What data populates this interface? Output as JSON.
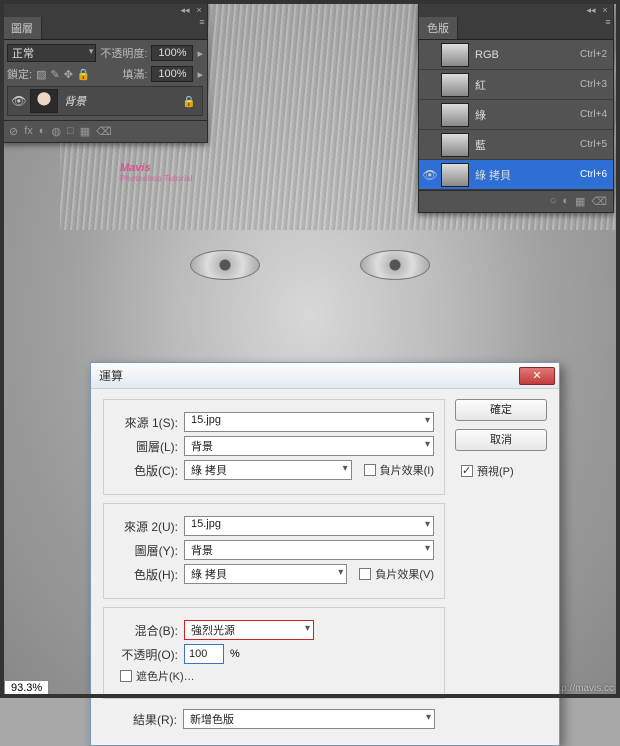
{
  "canvas": {
    "zoom": "93.3%",
    "watermark": "Mavis",
    "watermark_sub": "Photoshop Tutorial",
    "site": "http://mavis.cc"
  },
  "layers_panel": {
    "tab": "圖層",
    "blend_mode": "正常",
    "opacity_label": "不透明度:",
    "opacity_value": "100%",
    "lock_label": "鎖定:",
    "fill_label": "填滿:",
    "fill_value": "100%",
    "layer": {
      "name": "背景"
    },
    "foot_icons": [
      "⊘",
      "fx",
      "◐",
      "◍",
      "□",
      "▦",
      "⌫"
    ]
  },
  "channels_panel": {
    "tab": "色版",
    "items": [
      {
        "name": "RGB",
        "shortcut": "Ctrl+2",
        "selected": false,
        "eye": false
      },
      {
        "name": "紅",
        "shortcut": "Ctrl+3",
        "selected": false,
        "eye": false
      },
      {
        "name": "綠",
        "shortcut": "Ctrl+4",
        "selected": false,
        "eye": false
      },
      {
        "name": "藍",
        "shortcut": "Ctrl+5",
        "selected": false,
        "eye": false
      },
      {
        "name": "綠 拷貝",
        "shortcut": "Ctrl+6",
        "selected": true,
        "eye": true
      }
    ],
    "foot_icons": [
      "○",
      "◐",
      "▦",
      "⌫"
    ]
  },
  "dialog": {
    "title": "運算",
    "source1": {
      "label": "來源 1(S):",
      "file": "15.jpg",
      "layer_label": "圖層(L):",
      "layer": "背景",
      "channel_label": "色版(C):",
      "channel": "綠 拷貝",
      "invert": "負片效果(I)"
    },
    "source2": {
      "label": "來源 2(U):",
      "file": "15.jpg",
      "layer_label": "圖層(Y):",
      "layer": "背景",
      "channel_label": "色版(H):",
      "channel": "綠 拷貝",
      "invert": "負片效果(V)"
    },
    "blend": {
      "label": "混合(B):",
      "value": "強烈光源",
      "opacity_label": "不透明(O):",
      "opacity_value": "100",
      "opacity_unit": "%",
      "mask": "遮色片(K)…"
    },
    "result": {
      "label": "結果(R):",
      "value": "新增色版"
    },
    "buttons": {
      "ok": "確定",
      "cancel": "取消",
      "preview": "預視(P)"
    }
  }
}
